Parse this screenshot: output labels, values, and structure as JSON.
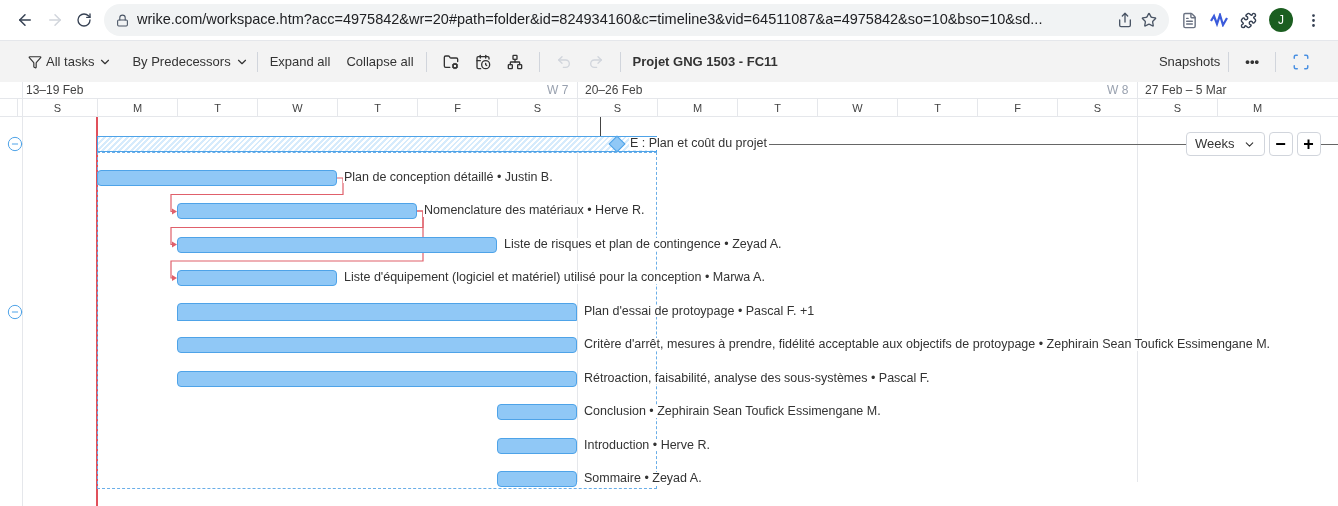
{
  "browser": {
    "url": "wrike.com/workspace.htm?acc=4975842&wr=20#path=folder&id=824934160&c=timeline3&vid=64511087&a=4975842&so=10&bso=10&sd...",
    "forward_disabled": true,
    "avatar": "J"
  },
  "toolbar": {
    "filter": "All tasks",
    "grouping": "By Predecessors",
    "expand": "Expand all",
    "collapse": "Collapse all",
    "undo_disabled": true,
    "redo_disabled": true,
    "project": "Projet GNG 1503 - FC11",
    "snapshots": "Snapshots",
    "more": "•••"
  },
  "timeline": {
    "weeks": [
      {
        "range": "13–19 Feb",
        "number": "W 7"
      },
      {
        "range": "20–26 Feb",
        "number": "W 8"
      },
      {
        "range": "27 Feb – 5 Mar"
      }
    ],
    "days": [
      "S",
      "M",
      "T",
      "W",
      "T",
      "F",
      "S",
      "S",
      "M",
      "T",
      "W",
      "T",
      "F",
      "S",
      "S",
      "M"
    ],
    "scale": "Weeks",
    "zoom_out": "−",
    "zoom_in": "+"
  },
  "tasks": [
    {
      "kind": "group",
      "label": "E : Plan et coût du projet",
      "expanded": true
    },
    {
      "kind": "task",
      "label": "Plan de conception détaillé • Justin B."
    },
    {
      "kind": "task",
      "label": "Nomenclature des matériaux • Herve R."
    },
    {
      "kind": "task",
      "label": "Liste de risques et plan de contingence • Zeyad A."
    },
    {
      "kind": "task",
      "label": "Liste d'équipement (logiciel et matériel) utilisé pour la conception • Marwa A."
    },
    {
      "kind": "subgroup",
      "label": "Plan d'essai de protoypage • Pascal F. +1",
      "expanded": true
    },
    {
      "kind": "task",
      "label": "Critère d'arrêt, mesures à prendre, fidélité acceptable aux objectifs de protoypage • Zephirain Sean Toufick Essimengane M."
    },
    {
      "kind": "task",
      "label": "Rétroaction, faisabilité, analyse des sous-systèmes • Pascal F."
    },
    {
      "kind": "task",
      "label": "Conclusion • Zephirain Sean Toufick Essimengane M."
    },
    {
      "kind": "task",
      "label": "Introduction • Herve R."
    },
    {
      "kind": "task",
      "label": "Sommaire • Zeyad A."
    }
  ]
}
